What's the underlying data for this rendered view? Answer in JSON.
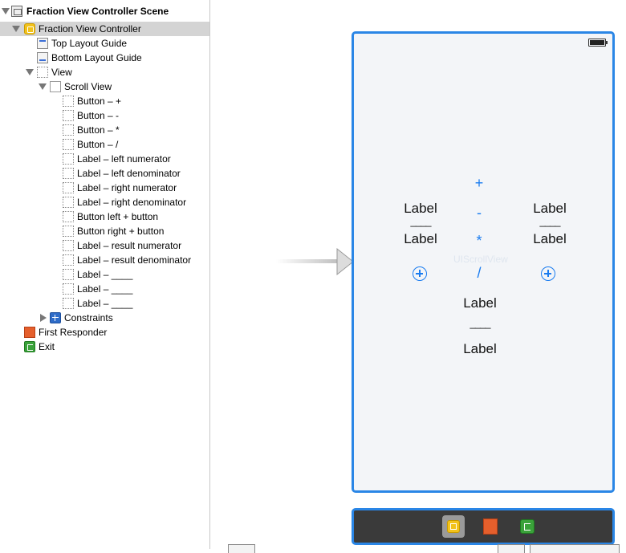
{
  "outline": {
    "items": [
      {
        "label": "Fraction View Controller Scene",
        "bold": true
      },
      {
        "label": "Fraction View Controller"
      },
      {
        "label": "Top Layout Guide"
      },
      {
        "label": "Bottom Layout Guide"
      },
      {
        "label": "View"
      },
      {
        "label": "Scroll View"
      },
      {
        "label": "Button – +"
      },
      {
        "label": "Button – -"
      },
      {
        "label": "Button – *"
      },
      {
        "label": "Button – /"
      },
      {
        "label": "Label – left numerator"
      },
      {
        "label": "Label – left denominator"
      },
      {
        "label": "Label – right numerator"
      },
      {
        "label": "Label – right denominator"
      },
      {
        "label": "Button left + button"
      },
      {
        "label": "Button right + button"
      },
      {
        "label": "Label – result numerator"
      },
      {
        "label": "Label – result denominator"
      },
      {
        "label": "Label – ____"
      },
      {
        "label": "Label – ____"
      },
      {
        "label": "Label – ____"
      },
      {
        "label": "Constraints"
      },
      {
        "label": "First Responder"
      },
      {
        "label": "Exit"
      }
    ]
  },
  "device": {
    "left_numerator": "Label",
    "left_line": "____",
    "left_denominator": "Label",
    "right_numerator": "Label",
    "right_line": "____",
    "right_denominator": "Label",
    "op_plus": "+",
    "op_minus": "-",
    "op_mult": "*",
    "op_div": "/",
    "result_numerator": "Label",
    "result_line": "____",
    "result_denominator": "Label",
    "scroll_hint": "UIScrollView"
  },
  "icons": {
    "scene": "scene-icon",
    "view_controller": "view-controller-icon",
    "layout_guide": "layout-guide-icon",
    "view": "view-icon",
    "constraints": "constraints-icon",
    "first_responder": "first-responder-icon",
    "exit": "exit-icon"
  },
  "colors": {
    "selection": "#2a86e6",
    "button_tint": "#1a7cf0"
  }
}
